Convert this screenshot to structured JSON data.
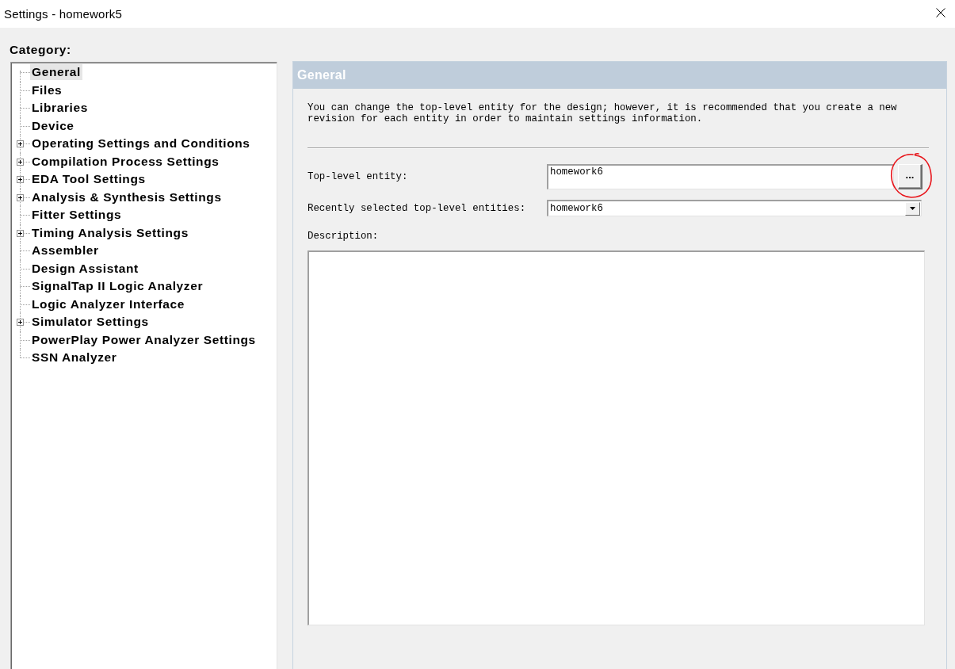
{
  "window": {
    "title": "Settings - homework5"
  },
  "category": {
    "label": "Category:",
    "items": [
      {
        "label": "General",
        "kind": "leaf",
        "selected": true
      },
      {
        "label": "Files",
        "kind": "leaf",
        "selected": false
      },
      {
        "label": "Libraries",
        "kind": "leaf",
        "selected": false
      },
      {
        "label": "Device",
        "kind": "leaf",
        "selected": false
      },
      {
        "label": "Operating Settings and Conditions",
        "kind": "group",
        "expanded": false,
        "selected": false
      },
      {
        "label": "Compilation Process Settings",
        "kind": "group",
        "expanded": false,
        "selected": false
      },
      {
        "label": "EDA Tool Settings",
        "kind": "group",
        "expanded": false,
        "selected": false
      },
      {
        "label": "Analysis & Synthesis Settings",
        "kind": "group",
        "expanded": false,
        "selected": false
      },
      {
        "label": "Fitter Settings",
        "kind": "leaf",
        "selected": false
      },
      {
        "label": "Timing Analysis Settings",
        "kind": "group",
        "expanded": false,
        "selected": false
      },
      {
        "label": "Assembler",
        "kind": "leaf",
        "selected": false
      },
      {
        "label": "Design Assistant",
        "kind": "leaf",
        "selected": false
      },
      {
        "label": "SignalTap II Logic Analyzer",
        "kind": "leaf",
        "selected": false
      },
      {
        "label": "Logic Analyzer Interface",
        "kind": "leaf",
        "selected": false
      },
      {
        "label": "Simulator Settings",
        "kind": "group",
        "expanded": false,
        "selected": false
      },
      {
        "label": "PowerPlay Power Analyzer Settings",
        "kind": "leaf",
        "selected": false
      },
      {
        "label": "SSN Analyzer",
        "kind": "leaf",
        "selected": false
      }
    ]
  },
  "panel": {
    "title": "General",
    "description": "You can change the top-level entity for the design; however, it is recommended that you create a new revision for each entity in order to maintain settings information.",
    "top_level_entity": {
      "label": "Top-level entity:",
      "value": "homework6",
      "browse_button": {
        "label": "...",
        "circled": true
      }
    },
    "recent_entities": {
      "label": "Recently selected top-level entities:",
      "value": "homework6"
    },
    "description_field": {
      "label": "Description:"
    }
  }
}
